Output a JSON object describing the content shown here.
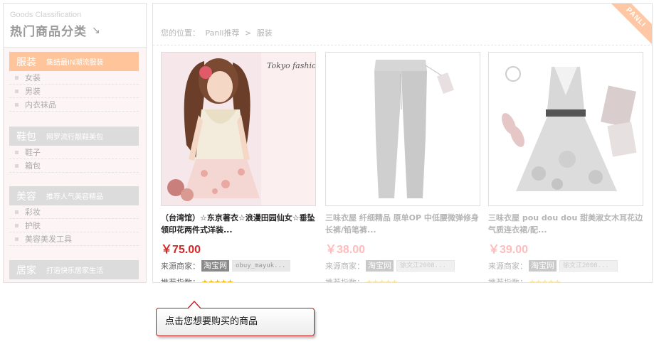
{
  "sidebar": {
    "title_en": "Goods Classification",
    "title_cn": "热门商品分类",
    "title_arrow": "↘",
    "categories": [
      {
        "name": "服装",
        "desc": "集结最IN潮流服装",
        "items": [
          "女装",
          "男装",
          "内衣袜品"
        ]
      },
      {
        "name": "鞋包",
        "desc": "网罗流行靓鞋美包",
        "items": [
          "鞋子",
          "箱包"
        ]
      },
      {
        "name": "美容",
        "desc": "推荐人气美容精品",
        "items": [
          "彩妆",
          "护肤",
          "美容美发工具"
        ]
      },
      {
        "name": "居家",
        "desc": "打造快乐居家生活",
        "items": []
      }
    ]
  },
  "breadcrumb": {
    "label": "您的位置：",
    "parts": [
      "Panli推荐",
      ">",
      "服装"
    ]
  },
  "ribbon": "PANLI",
  "products": [
    {
      "title": "（台湾馆）☆东京著衣☆浪漫田园仙女☆垂坠领印花两件式洋装...",
      "price": "￥75.00",
      "source_label": "来源商家：",
      "source_site": "淘宝网",
      "seller": "obuy_mayuk...",
      "rec_label": "推荐指数：",
      "stars": "★★★★★",
      "image_text": "Tokyo fashion co."
    },
    {
      "title": "三味衣屋 纤细精品 原单OP 中低腰微弹修身长裤/铅笔裤...",
      "price": "￥38.00",
      "source_label": "来源商家：",
      "source_site": "淘宝网",
      "seller": "徐文江2008...",
      "rec_label": "推荐指数：",
      "stars": "★★★★★"
    },
    {
      "title": "三味衣屋 pou dou dou 甜美淑女木耳花边气质连衣裙/配...",
      "price": "￥39.00",
      "source_label": "来源商家：",
      "source_site": "淘宝网",
      "seller": "徐文江2008...",
      "rec_label": "推荐指数：",
      "stars": "★★★★★"
    }
  ],
  "tooltip": "点击您想要购买的商品",
  "colors": {
    "accent_red": "#c1191b",
    "price_red": "#d22a2a",
    "category_active": "#ffc499"
  }
}
